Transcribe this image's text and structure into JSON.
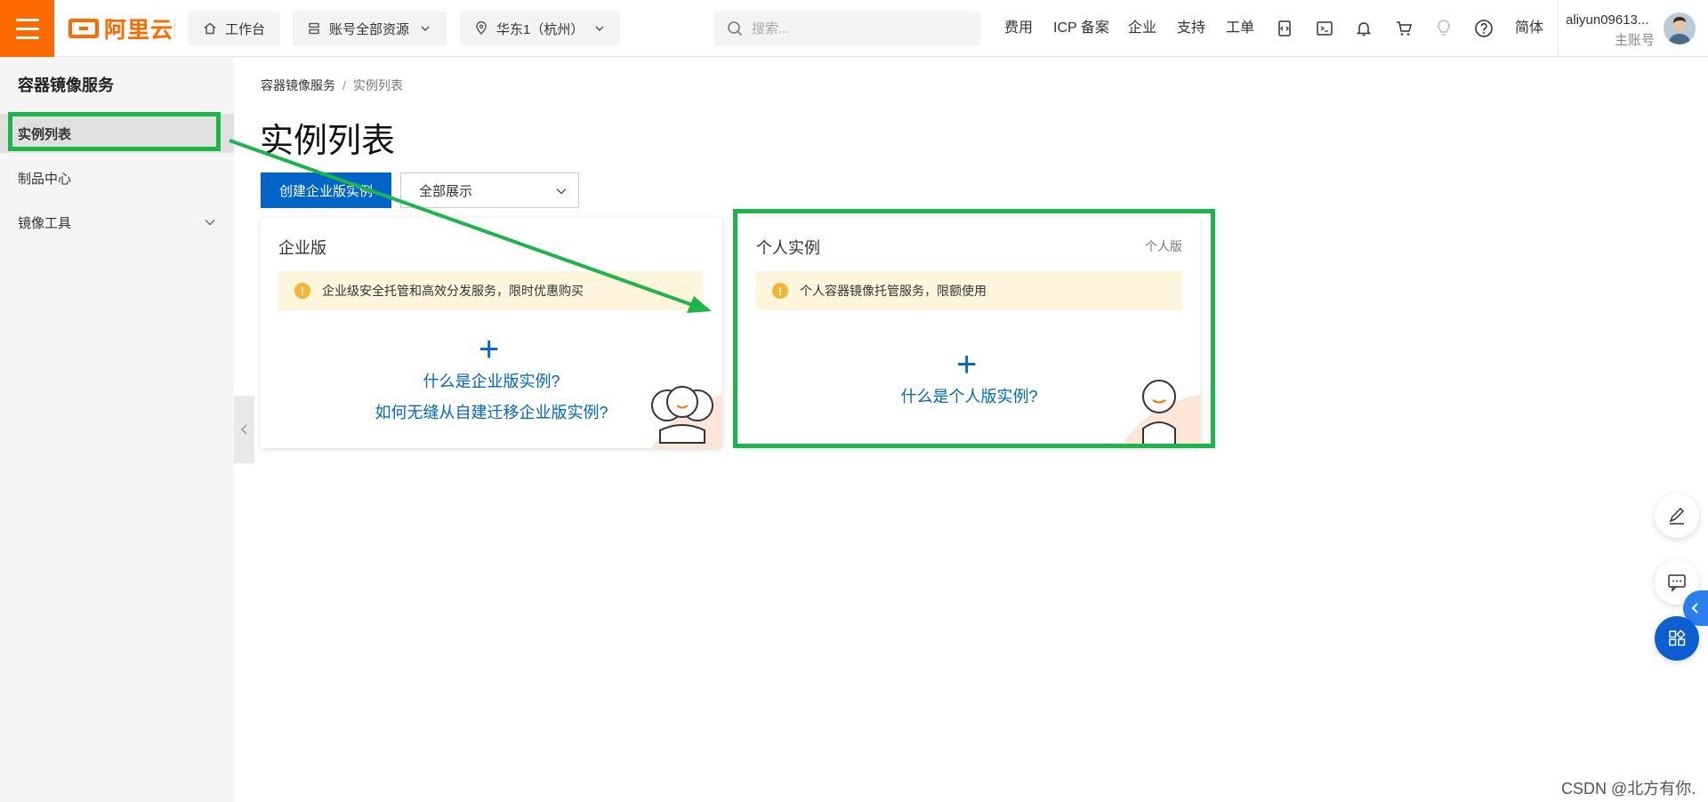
{
  "topbar": {
    "logo_text": "阿里云",
    "workbench": "工作台",
    "resources": "账号全部资源",
    "region": "华东1（杭州）",
    "search_placeholder": "搜索...",
    "links": [
      "费用",
      "ICP 备案",
      "企业",
      "支持",
      "工单"
    ],
    "language": "简体",
    "account_name": "aliyun09613...",
    "account_role": "主账号",
    "icons": [
      "code-icon",
      "terminal-icon",
      "bell-icon",
      "cart-icon",
      "lightbulb-icon",
      "help-icon"
    ]
  },
  "sidebar": {
    "title": "容器镜像服务",
    "items": [
      {
        "label": "实例列表",
        "active": true
      },
      {
        "label": "制品中心",
        "active": false
      },
      {
        "label": "镜像工具",
        "active": false,
        "expandable": true
      }
    ]
  },
  "breadcrumb": [
    "容器镜像服务",
    "实例列表"
  ],
  "page_title": "实例列表",
  "toolbar": {
    "create_button": "创建企业版实例",
    "filter_value": "全部展示"
  },
  "cards": {
    "enterprise": {
      "title": "企业版",
      "notice": "企业级安全托管和高效分发服务，限时优惠购买",
      "plus": "+",
      "links": [
        "什么是企业版实例?",
        "如何无缝从自建迁移企业版实例?"
      ]
    },
    "personal": {
      "title": "个人实例",
      "tag": "个人版",
      "notice": "个人容器镜像托管服务，限额使用",
      "plus": "+",
      "links": [
        "什么是个人版实例?"
      ]
    }
  },
  "annotation": {
    "color": "#1db54a"
  },
  "colors": {
    "brand": "#ff6a00",
    "primary": "#0064c8",
    "notice_bg": "#fef5dc"
  },
  "watermark": "CSDN @北方有你."
}
